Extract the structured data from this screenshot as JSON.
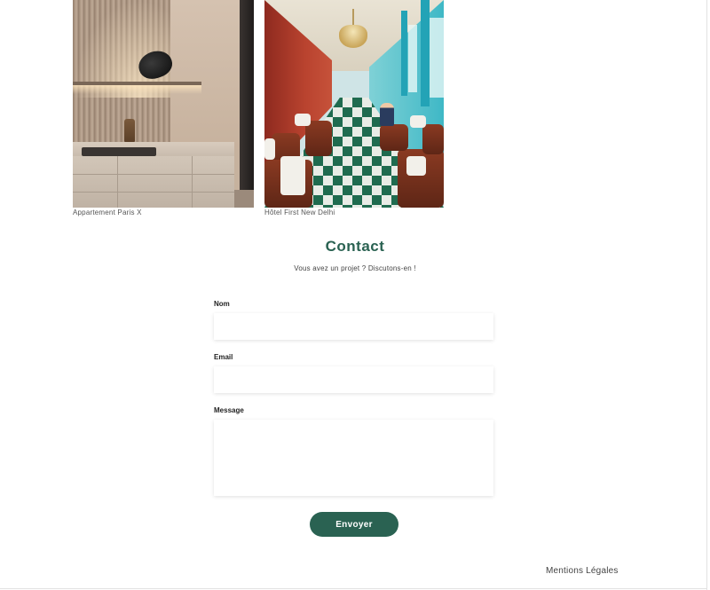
{
  "projects": [
    {
      "caption": "Appartement Paris X"
    },
    {
      "caption": "Hôtel First New Delhi"
    }
  ],
  "contact": {
    "title": "Contact",
    "subtitle": "Vous avez un projet ? Discutons-en !",
    "fields": {
      "name_label": "Nom",
      "name_value": "",
      "email_label": "Email",
      "email_value": "",
      "message_label": "Message",
      "message_value": ""
    },
    "submit_label": "Envoyer"
  },
  "footer": {
    "legal_label": "Mentions Légales"
  },
  "colors": {
    "accent": "#2a6252",
    "background": "#ffffff"
  }
}
